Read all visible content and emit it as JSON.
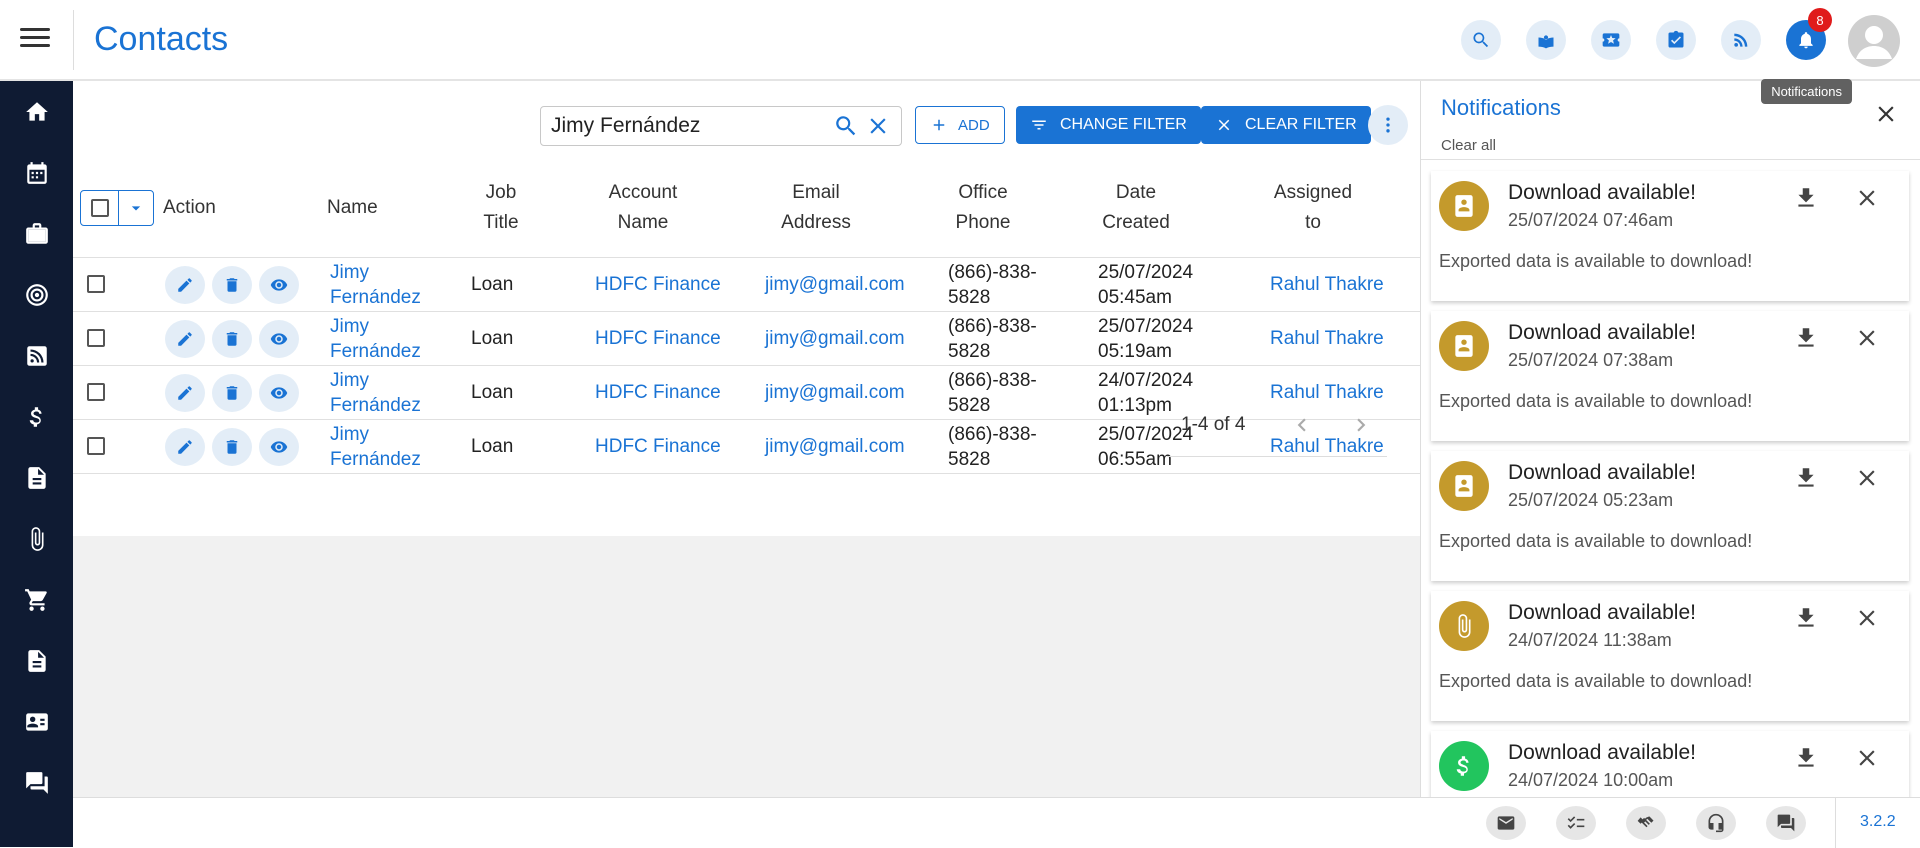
{
  "header": {
    "title": "Contacts",
    "notification_count": "8",
    "tooltip": "Notifications",
    "icons": [
      "search-icon",
      "knowledge-icon",
      "ticket-icon",
      "tasks-icon",
      "feed-icon",
      "bell-icon"
    ]
  },
  "sidebar": {
    "items": [
      "home-icon",
      "calendar-icon",
      "briefcase-icon",
      "target-icon",
      "feed-icon",
      "dollar-icon",
      "document-icon",
      "attachment-icon",
      "cart-icon",
      "file-icon",
      "contact-card-icon",
      "chat-icon"
    ]
  },
  "toolbar": {
    "search_value": "Jimy Fernández",
    "add_label": "ADD",
    "change_filter_label": "CHANGE FILTER",
    "clear_filter_label": "CLEAR FILTER"
  },
  "table": {
    "columns": {
      "action": "Action",
      "name": "Name",
      "job_title_1": "Job",
      "job_title_2": "Title",
      "account_1": "Account",
      "account_2": "Name",
      "email_1": "Email",
      "email_2": "Address",
      "phone_1": "Office",
      "phone_2": "Phone",
      "date_1": "Date",
      "date_2": "Created",
      "assigned_1": "Assigned",
      "assigned_2": "to"
    },
    "rows": [
      {
        "first": "Jimy",
        "last": "Fernández",
        "job": "Loan",
        "account": "HDFC Finance",
        "email": "jimy@gmail.com",
        "phone1": "(866)-838-",
        "phone2": "5828",
        "date": "25/07/2024",
        "time": "05:45am",
        "assigned": "Rahul Thakre"
      },
      {
        "first": "Jimy",
        "last": "Fernández",
        "job": "Loan",
        "account": "HDFC Finance",
        "email": "jimy@gmail.com",
        "phone1": "(866)-838-",
        "phone2": "5828",
        "date": "25/07/2024",
        "time": "05:19am",
        "assigned": "Rahul Thakre"
      },
      {
        "first": "Jimy",
        "last": "Fernández",
        "job": "Loan",
        "account": "HDFC Finance",
        "email": "jimy@gmail.com",
        "phone1": "(866)-838-",
        "phone2": "5828",
        "date": "24/07/2024",
        "time": "01:13pm",
        "assigned": "Rahul Thakre"
      },
      {
        "first": "Jimy",
        "last": "Fernández",
        "job": "Loan",
        "account": "HDFC Finance",
        "email": "jimy@gmail.com",
        "phone1": "(866)-838-",
        "phone2": "5828",
        "date": "25/07/2024",
        "time": "06:55am",
        "assigned": "Rahul Thakre"
      }
    ],
    "pagination": "1-4 of 4"
  },
  "notifications": {
    "title": "Notifications",
    "clear_all": "Clear all",
    "items": [
      {
        "title": "Download available!",
        "date": "25/07/2024 07:46am",
        "message": "Exported data is available to download!",
        "icon": "contact-book-icon",
        "color": "#c49a2c"
      },
      {
        "title": "Download available!",
        "date": "25/07/2024 07:38am",
        "message": "Exported data is available to download!",
        "icon": "contact-book-icon",
        "color": "#c49a2c"
      },
      {
        "title": "Download available!",
        "date": "25/07/2024 05:23am",
        "message": "Exported data is available to download!",
        "icon": "contact-book-icon",
        "color": "#c49a2c"
      },
      {
        "title": "Download available!",
        "date": "24/07/2024 11:38am",
        "message": "Exported data is available to download!",
        "icon": "attachment-icon",
        "color": "#c49a2c"
      },
      {
        "title": "Download available!",
        "date": "24/07/2024 10:00am",
        "message": "",
        "icon": "dollar-icon",
        "color": "#22c55e"
      }
    ]
  },
  "footer": {
    "version": "3.2.2",
    "icons": [
      "mail-icon",
      "checklist-icon",
      "handshake-icon",
      "headset-icon",
      "chat-icon"
    ]
  },
  "colors": {
    "accent": "#1a73d4",
    "sidebar": "#0f1b33",
    "badge": "#e01b1b"
  }
}
